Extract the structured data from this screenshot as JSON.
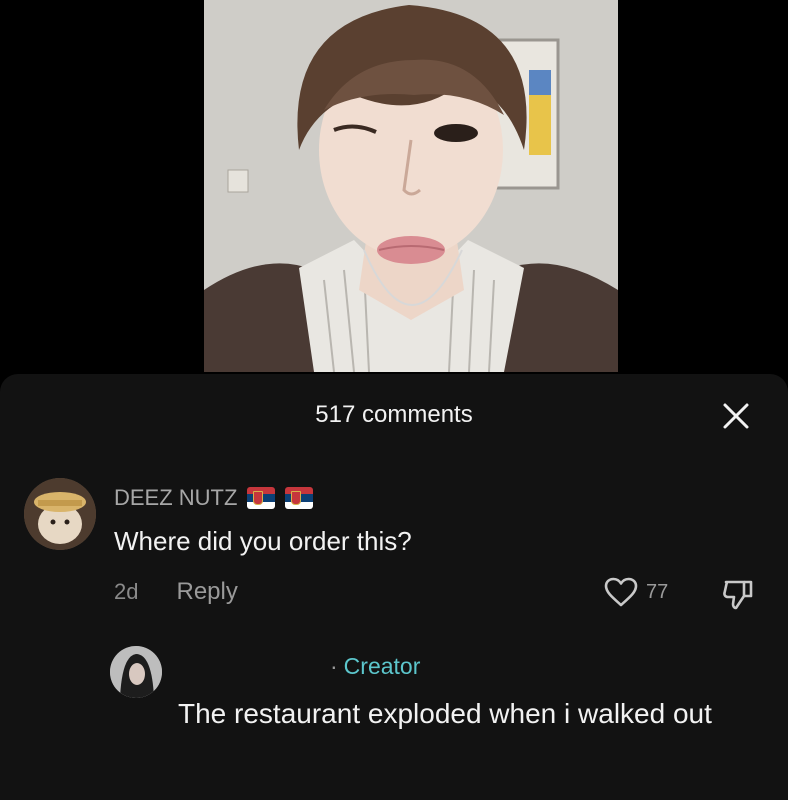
{
  "comments_header": {
    "count_label": "517 comments"
  },
  "comment": {
    "username": "DEEZ NUTZ",
    "flags": [
      "serbia-flag",
      "serbia-flag"
    ],
    "text": "Where did you order this?",
    "time": "2d",
    "reply_label": "Reply",
    "like_count": "77"
  },
  "reply": {
    "separator": "·",
    "badge": "Creator",
    "text": "The restaurant exploded when i walked out"
  },
  "icons": {
    "close": "close-icon",
    "like": "heart-icon",
    "dislike": "thumbs-down-icon"
  },
  "colors": {
    "sheet_background": "#121212",
    "creator_accent": "#5cc6cc",
    "muted_text": "#9a9a9a"
  }
}
